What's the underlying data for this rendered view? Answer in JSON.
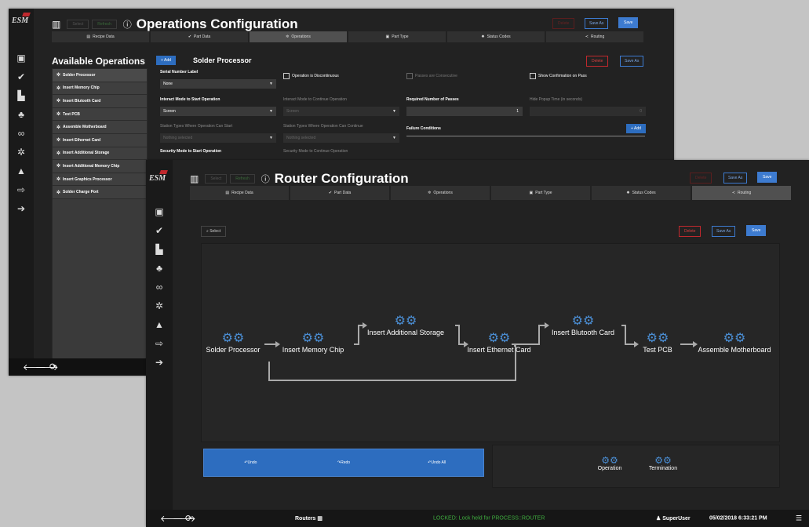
{
  "app": {
    "logo": "ESM"
  },
  "ops_window": {
    "toolbar": {
      "select_label": "Select",
      "refresh_label": "Refresh",
      "title": "Operations Configuration",
      "delete_label": "Delete",
      "save_as_label": "Save As",
      "save_label": "Save"
    },
    "tabs": [
      {
        "label": "Recipe Data",
        "icon": "book-icon"
      },
      {
        "label": "Part Data",
        "icon": "check-circle-icon"
      },
      {
        "label": "Operations",
        "icon": "gears-icon"
      },
      {
        "label": "Part Type",
        "icon": "image-icon"
      },
      {
        "label": "Status Codes",
        "icon": "bug-icon"
      },
      {
        "label": "Routing",
        "icon": "share-icon"
      }
    ],
    "active_tab": "Operations",
    "available_title": "Available Operations",
    "operations": [
      "Solder Processor",
      "Insert Memory Chip",
      "Insert Blutooth Card",
      "Test PCB",
      "Assemble Motherboard",
      "Insert Ethernet Card",
      "Insert Additional Storage",
      "Insert Additional Memory Chip",
      "Insert Graphics Processor",
      "Solder Charge Port"
    ],
    "add_label": "+ Add",
    "current_operation": "Solder Processor",
    "delete_label": "Delete",
    "save_as_label": "Save As",
    "form": {
      "serial_label": "Serial Number Label",
      "serial_value": "None",
      "op_discontinuous": "Operation is Discontinuous",
      "passes_consecutive": "Passes are Consecutive",
      "show_confirmation": "Show Confirmation on Pass",
      "interact_start_label": "Interact Mode to Start Operation",
      "interact_start_value": "Screen",
      "interact_continue_label": "Interact Mode to Continue Operation",
      "interact_continue_value": "Screen",
      "required_passes_label": "Required Number of Passes",
      "required_passes_value": "1",
      "hide_popup_label": "Hide Popup Time (in seconds)",
      "hide_popup_value": "0",
      "station_start_label": "Station Types Where Operation Can Start",
      "station_start_value": "Nothing selected",
      "station_continue_label": "Station Types Where Operation Can Continue",
      "station_continue_value": "Nothing selected",
      "failure_label": "Failure Conditions",
      "failure_add": "+ Add",
      "security_start_label": "Security Mode to Start Operation",
      "security_continue_label": "Security Mode to Continue Operation"
    }
  },
  "router_window": {
    "toolbar": {
      "select_label": "Select",
      "refresh_label": "Refresh",
      "title": "Router Configuration",
      "delete_label": "Delete",
      "save_as_label": "Save As",
      "save_label": "Save"
    },
    "tabs": [
      {
        "label": "Recipe Data",
        "icon": "book-icon"
      },
      {
        "label": "Part Data",
        "icon": "check-circle-icon"
      },
      {
        "label": "Operations",
        "icon": "gears-icon"
      },
      {
        "label": "Part Type",
        "icon": "image-icon"
      },
      {
        "label": "Status Codes",
        "icon": "bug-icon"
      },
      {
        "label": "Routing",
        "icon": "share-icon"
      }
    ],
    "active_tab": "Routing",
    "search_label": "Select",
    "delete_label": "Delete",
    "save_as_label": "Save As",
    "save_label": "Save",
    "flow": [
      "Solder Processor",
      "Insert Memory Chip",
      "Insert Additional Storage",
      "Insert Ethernet Card",
      "Insert Blutooth Card",
      "Test PCB",
      "Assemble Motherboard"
    ],
    "undo": {
      "undo": "Undo",
      "redo": "Redo",
      "undo_all": "Undo All"
    },
    "legend": {
      "operation": "Operation",
      "termination": "Termination"
    },
    "status": {
      "module": "Routers",
      "lock": "LOCKED: Lock held for PROCESS::ROUTER",
      "user": "SuperUser",
      "datetime": "05/02/2018 6:33:21 PM"
    },
    "colors": {
      "accent": "#3d7bd0",
      "lock_text": "#3fae3f",
      "delete": "#c0282d"
    }
  }
}
